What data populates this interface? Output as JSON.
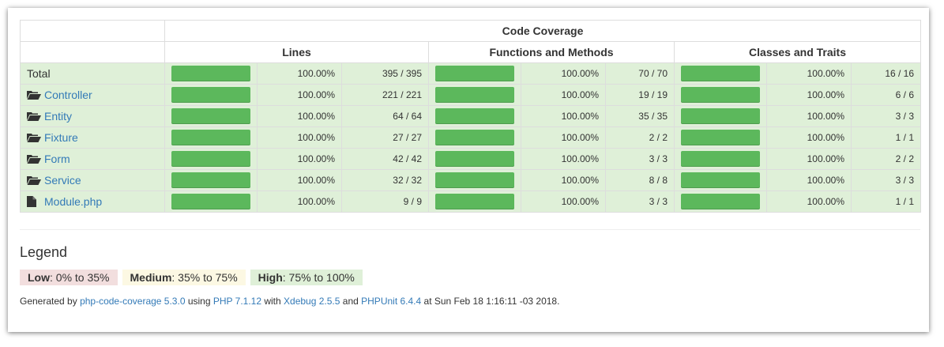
{
  "header": {
    "code_coverage": "Code Coverage",
    "lines": "Lines",
    "functions": "Functions and Methods",
    "classes": "Classes and Traits"
  },
  "rows": [
    {
      "name": "Total",
      "type": "total",
      "lines_pct": "100.00%",
      "lines_count": "395 / 395",
      "lines_fill": 1.0,
      "func_pct": "100.00%",
      "func_count": "70 / 70",
      "func_fill": 1.0,
      "class_pct": "100.00%",
      "class_count": "16 / 16",
      "class_fill": 1.0
    },
    {
      "name": "Controller",
      "type": "folder",
      "lines_pct": "100.00%",
      "lines_count": "221 / 221",
      "lines_fill": 1.0,
      "func_pct": "100.00%",
      "func_count": "19 / 19",
      "func_fill": 1.0,
      "class_pct": "100.00%",
      "class_count": "6 / 6",
      "class_fill": 1.0
    },
    {
      "name": "Entity",
      "type": "folder",
      "lines_pct": "100.00%",
      "lines_count": "64 / 64",
      "lines_fill": 1.0,
      "func_pct": "100.00%",
      "func_count": "35 / 35",
      "func_fill": 1.0,
      "class_pct": "100.00%",
      "class_count": "3 / 3",
      "class_fill": 1.0
    },
    {
      "name": "Fixture",
      "type": "folder",
      "lines_pct": "100.00%",
      "lines_count": "27 / 27",
      "lines_fill": 1.0,
      "func_pct": "100.00%",
      "func_count": "2 / 2",
      "func_fill": 1.0,
      "class_pct": "100.00%",
      "class_count": "1 / 1",
      "class_fill": 1.0
    },
    {
      "name": "Form",
      "type": "folder",
      "lines_pct": "100.00%",
      "lines_count": "42 / 42",
      "lines_fill": 1.0,
      "func_pct": "100.00%",
      "func_count": "3 / 3",
      "func_fill": 1.0,
      "class_pct": "100.00%",
      "class_count": "2 / 2",
      "class_fill": 1.0
    },
    {
      "name": "Service",
      "type": "folder",
      "lines_pct": "100.00%",
      "lines_count": "32 / 32",
      "lines_fill": 1.0,
      "func_pct": "100.00%",
      "func_count": "8 / 8",
      "func_fill": 1.0,
      "class_pct": "100.00%",
      "class_count": "3 / 3",
      "class_fill": 1.0
    },
    {
      "name": "Module.php",
      "type": "file",
      "lines_pct": "100.00%",
      "lines_count": "9 / 9",
      "lines_fill": 1.0,
      "func_pct": "100.00%",
      "func_count": "3 / 3",
      "func_fill": 1.0,
      "class_pct": "100.00%",
      "class_count": "1 / 1",
      "class_fill": 1.0
    }
  ],
  "legend": {
    "title": "Legend",
    "low_label": "Low",
    "low_range": ": 0% to 35%",
    "medium_label": "Medium",
    "medium_range": ": 35% to 75%",
    "high_label": "High",
    "high_range": ": 75% to 100%"
  },
  "footer": {
    "generated_by": "Generated by ",
    "tool": "php-code-coverage 5.3.0",
    "using": " using ",
    "php": "PHP 7.1.12",
    "with": " with ",
    "xdebug": "Xdebug 2.5.5",
    "and": " and ",
    "phpunit": "PHPUnit 6.4.4",
    "at": " at Sun Feb 18 1:16:11 -03 2018."
  },
  "colors": {
    "bar": "#5cb85c",
    "high_bg": "#dff0d8",
    "medium_bg": "#fcf8e3",
    "low_bg": "#f2dede",
    "link": "#337ab7"
  },
  "icons": {
    "folder": "folder-open-icon",
    "file": "file-icon"
  }
}
